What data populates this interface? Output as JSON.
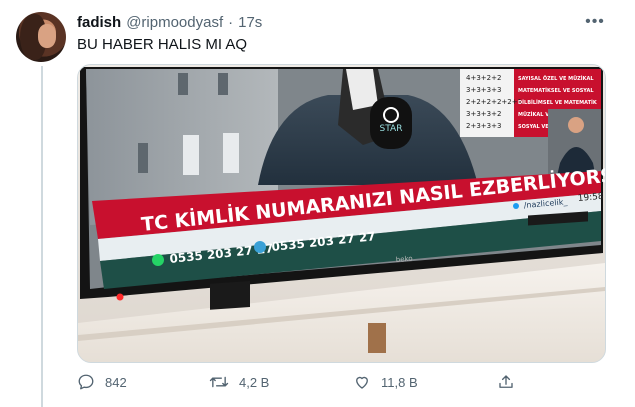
{
  "tweet": {
    "display_name": "fadish",
    "handle": "@ripmoodyasf",
    "separator": "·",
    "time": "17s",
    "text": "BU HABER HALIS MI AQ",
    "more_label": "•••"
  },
  "media": {
    "headline": "TC KİMLİK NUMARANIZI NASIL EZBERLİYORSUNUZ?",
    "twitter_handle": "/nazlicelik_",
    "clock": "19:58",
    "whatsapp_number": "0535 203 27 27",
    "phone_number": "0535 203 27 27",
    "tv_brand": "beko",
    "mic_logo": "STAR",
    "math_rows": [
      "4+3+2+2",
      "3+3+3+3",
      "2+2+2+2+2+1",
      "3+3+3+2",
      "2+3+3+3"
    ],
    "category_rows": [
      "SAYISAL ÖZEL VE MÜZİKAL",
      "MATEMATİKSEL VE SOSYAL",
      "DİLBİLİMSEL VE MATEMATİK",
      "MÜZİKAL VE DİLBİLİMSEL",
      "SOSYAL VE GÖRSEL"
    ]
  },
  "actions": {
    "reply_count": "842",
    "retweet_count": "4,2 B",
    "like_count": "11,8 B"
  },
  "colors": {
    "text_primary": "#0f1419",
    "text_secondary": "#536471",
    "banner_red": "#c8102e",
    "screen_bottom": "#1e4f47",
    "stand": "#f1ece6"
  },
  "icons": {
    "reply": "speech-bubble",
    "retweet": "two-arrows-loop",
    "like": "heart-outline",
    "share": "arrow-up-from-tray",
    "more": "three-dots",
    "whatsapp": "whatsapp-logo",
    "phone": "phone-logo",
    "twitter": "bird-logo"
  }
}
